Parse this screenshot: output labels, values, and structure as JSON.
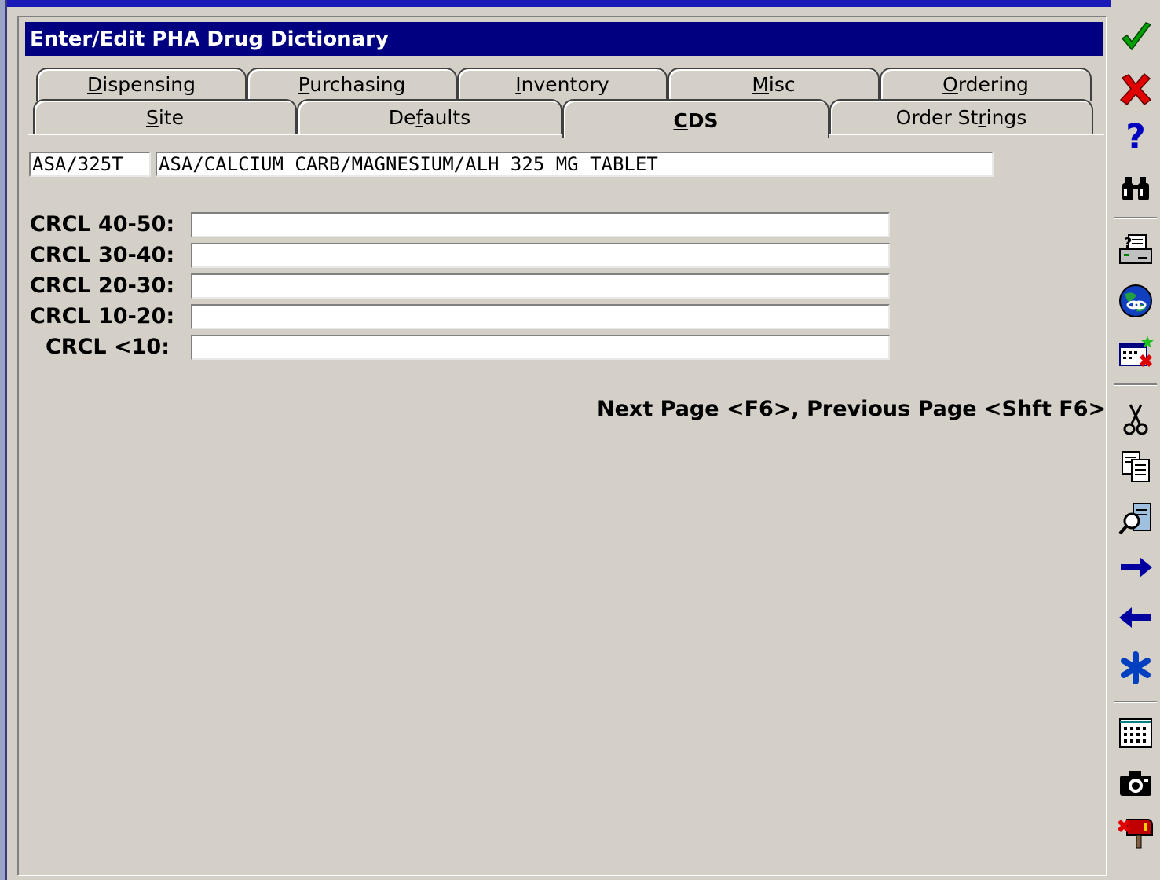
{
  "window": {
    "title": "Enter/Edit PHA Drug Dictionary"
  },
  "tabs": {
    "row1": [
      {
        "label": "Dispensing",
        "mnemonic": "D",
        "rest": "ispensing"
      },
      {
        "label": "Purchasing",
        "mnemonic": "P",
        "rest": "urchasing"
      },
      {
        "label": "Inventory",
        "mnemonic": "I",
        "rest": "nventory"
      },
      {
        "label": "Misc",
        "mnemonic": "M",
        "rest": "isc"
      },
      {
        "label": "Ordering",
        "mnemonic": "O",
        "rest": "rdering"
      }
    ],
    "row2": [
      {
        "label": "Site",
        "mnemonic": "S",
        "rest": "ite"
      },
      {
        "label": "Defaults",
        "pre": "De",
        "mnemonic": "f",
        "rest": "aults"
      },
      {
        "label": "CDS",
        "mnemonic": "C",
        "rest": "DS",
        "active": true
      },
      {
        "label": "Order Strings",
        "pre": "Order St",
        "mnemonic": "r",
        "rest": "ings"
      }
    ]
  },
  "drug": {
    "code": "ASA/325T",
    "description": "ASA/CALCIUM CARB/MAGNESIUM/ALH 325 MG TABLET"
  },
  "crcl_fields": [
    {
      "label": "CRCL 40-50:",
      "value": ""
    },
    {
      "label": "CRCL 30-40:",
      "value": ""
    },
    {
      "label": "CRCL 20-30:",
      "value": ""
    },
    {
      "label": "CRCL 10-20:",
      "value": ""
    },
    {
      "label": "CRCL <10:",
      "value": ""
    }
  ],
  "hint": "Next Page <F6>, Previous Page <Shft F6>",
  "toolbar": {
    "icons": [
      "ok-checkmark-icon",
      "cancel-x-icon",
      "help-question-icon",
      "find-binoculars-icon",
      "print-icon",
      "globe-link-icon",
      "delete-record-icon",
      "cut-scissors-icon",
      "copy-icon",
      "lookup-icon",
      "next-arrow-icon",
      "previous-arrow-icon",
      "asterisk-icon",
      "keypad-icon",
      "camera-icon",
      "exit-mailbox-icon"
    ]
  }
}
